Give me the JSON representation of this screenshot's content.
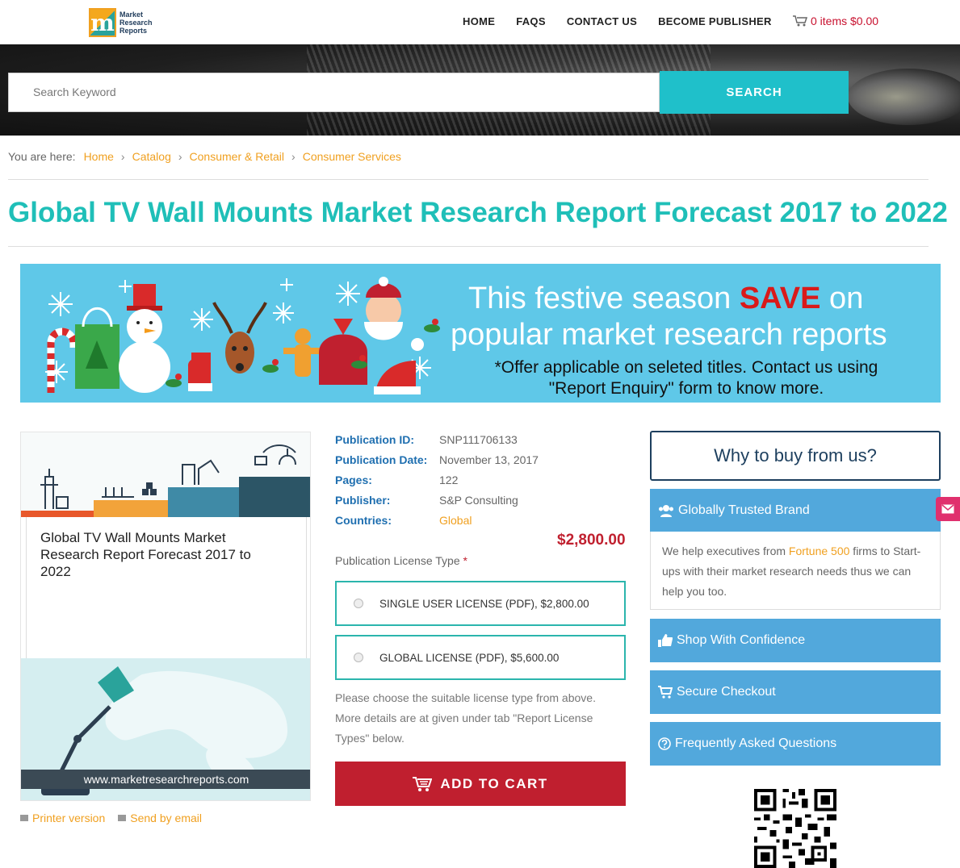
{
  "header": {
    "logo_text": [
      "Market",
      "Research",
      "Reports"
    ],
    "nav": [
      "HOME",
      "FAQS",
      "CONTACT US",
      "BECOME PUBLISHER"
    ],
    "cart": "0 items $0.00"
  },
  "search": {
    "placeholder": "Search Keyword",
    "button": "SEARCH"
  },
  "breadcrumb": {
    "prefix": "You are here:",
    "items": [
      "Home",
      "Catalog",
      "Consumer & Retail",
      "Consumer Services"
    ]
  },
  "page_title": "Global TV Wall Mounts Market Research Report Forecast 2017 to 2022",
  "banner": {
    "line1_pre": "This festive season ",
    "line1_save": "SAVE",
    "line1_post": " on",
    "line2": "popular market research reports",
    "line3": "*Offer applicable on seleted titles. Contact us using \"Report Enquiry\" form to know more."
  },
  "product_image": {
    "title": "Global TV Wall Mounts Market Research Report Forecast 2017 to 2022",
    "url": "www.marketresearchreports.com"
  },
  "actions": {
    "print": "Printer version",
    "email": "Send by email"
  },
  "meta": [
    {
      "label": "Publication ID:",
      "value": "SNP111706133"
    },
    {
      "label": "Publication Date:",
      "value": "November 13, 2017"
    },
    {
      "label": "Pages:",
      "value": "122"
    },
    {
      "label": "Publisher:",
      "value": "S&P Consulting"
    },
    {
      "label": "Countries:",
      "value": "Global"
    }
  ],
  "price": "$2,800.00",
  "license": {
    "label": "Publication License Type",
    "required": "*",
    "options": [
      "SINGLE USER LICENSE (PDF), $2,800.00",
      "GLOBAL LICENSE (PDF), $5,600.00"
    ],
    "note": "Please choose the suitable license type from above. More details are at given under tab \"Report License Types\" below."
  },
  "add_to_cart": "ADD TO CART",
  "sidebar": {
    "why": "Why to buy from us?",
    "trusted": {
      "title": "Globally Trusted Brand",
      "body_pre": "We help executives from ",
      "body_hl": "Fortune 500",
      "body_post": " firms to Start-ups with their market research needs thus we can help you too."
    },
    "shop": "Shop With Confidence",
    "secure": "Secure Checkout",
    "faq": "Frequently Asked Questions"
  },
  "colors": {
    "teal": "#1fbfb8",
    "cyan_button": "#1fc0ca",
    "orange": "#f0a020",
    "red": "#c01f2f",
    "blue_box": "#52a8dc",
    "navy": "#1d3f5e"
  }
}
